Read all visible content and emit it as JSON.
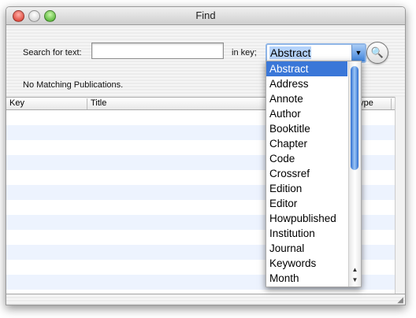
{
  "window": {
    "title": "Find"
  },
  "search": {
    "label": "Search for text:",
    "value": "",
    "key_label": "in key;",
    "key_value": "Abstract"
  },
  "status": "No Matching Publications.",
  "table": {
    "columns": [
      "Key",
      "Title",
      "Type"
    ]
  },
  "dropdown": {
    "options": [
      "Abstract",
      "Address",
      "Annote",
      "Author",
      "Booktitle",
      "Chapter",
      "Code",
      "Crossref",
      "Edition",
      "Editor",
      "Howpublished",
      "Institution",
      "Journal",
      "Keywords",
      "Month"
    ],
    "selected": "Abstract"
  }
}
